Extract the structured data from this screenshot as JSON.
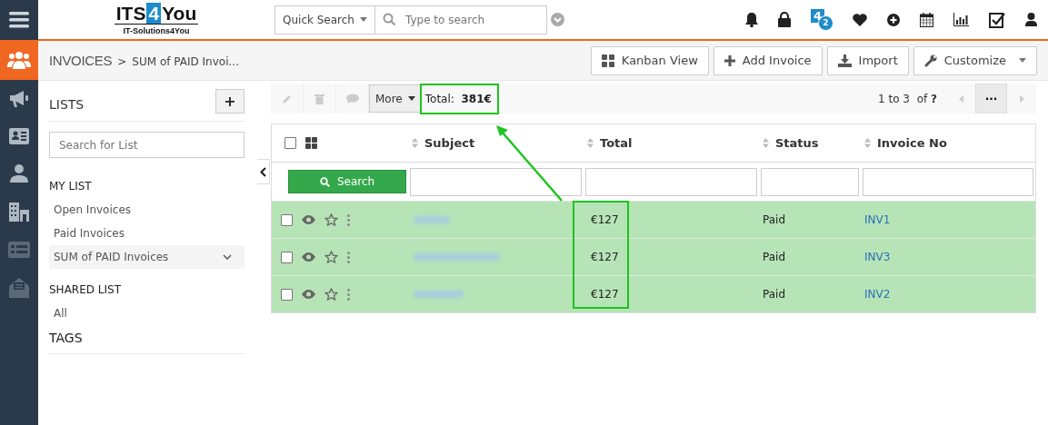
{
  "topbar": {
    "logo": {
      "before": "ITS",
      "mark": "4",
      "after": "You",
      "tagline": "IT-Solutions4You"
    },
    "search": {
      "scope": "Quick Search",
      "placeholder": "Type to search"
    },
    "app_badge": {
      "label": "4",
      "count": "2"
    }
  },
  "breadcrumb": {
    "module": "INVOICES",
    "separator": ">",
    "current": "SUM of PAID Invoi..."
  },
  "actions": [
    {
      "label": "Kanban View",
      "kind": "grid"
    },
    {
      "label": "Add Invoice",
      "kind": "plus"
    },
    {
      "label": "Import",
      "kind": "import"
    },
    {
      "label": "Customize",
      "kind": "wrench"
    }
  ],
  "sidebar": {
    "title": "LISTS",
    "add": "+",
    "search_placeholder": "Search for List",
    "sections": [
      {
        "title": "MY LIST",
        "items": [
          {
            "label": "Open Invoices",
            "selected": false
          },
          {
            "label": "Paid Invoices",
            "selected": false
          },
          {
            "label": "SUM of PAID Invoices",
            "selected": true
          }
        ]
      },
      {
        "title": "SHARED LIST",
        "items": [
          {
            "label": "All",
            "selected": false
          }
        ]
      }
    ],
    "tags_title": "TAGS"
  },
  "toolbar": {
    "more": "More",
    "total_label": "Total:",
    "total_value": "381€",
    "range": "1 to 3",
    "of": "of",
    "count": "?",
    "more_pages": "···"
  },
  "table": {
    "select_all_checked": false,
    "columns": [
      "Subject",
      "Total",
      "Status",
      "Invoice No"
    ],
    "search_button": "Search",
    "rows": [
      {
        "checked": false,
        "total": "€127",
        "status": "Paid",
        "invoice_no": "INV1"
      },
      {
        "checked": false,
        "total": "€127",
        "status": "Paid",
        "invoice_no": "INV3"
      },
      {
        "checked": false,
        "total": "€127",
        "status": "Paid",
        "invoice_no": "INV2"
      }
    ]
  }
}
